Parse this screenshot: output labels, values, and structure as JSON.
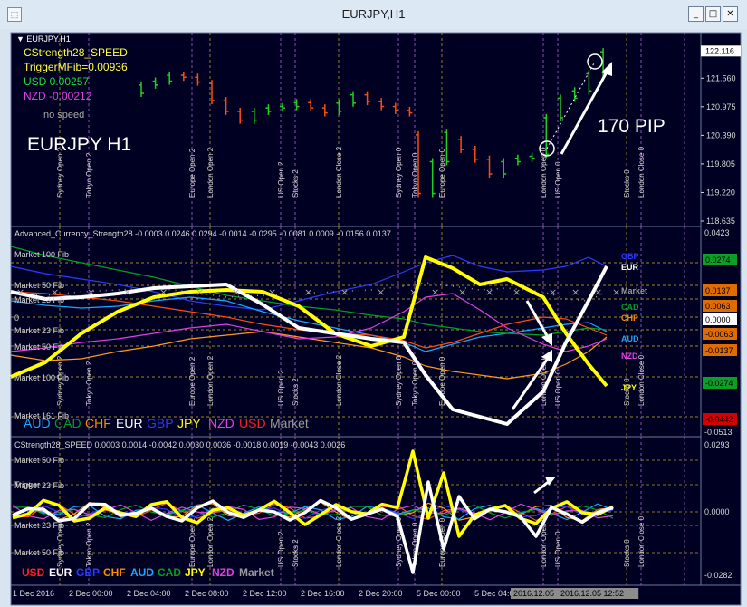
{
  "window": {
    "title": "EURJPY,H1",
    "minimize_glyph": "_",
    "maximize_glyph": "□",
    "close_glyph": "✕",
    "app_icon": "chart-window-icon"
  },
  "main_panel": {
    "label": "▼ EURJPY.H1",
    "indicator_name": "CStrength28_SPEED",
    "trigger_text": "TriggerMFib=0.00936",
    "usd_text": "USD 0.00257",
    "nzd_text": "NZD -0.00212",
    "nospeed_text": "no speed",
    "symbol_overlay": "EURJPY H1",
    "pip_overlay": "170 PIP",
    "price_labels": [
      "122.116",
      "121.560",
      "120.975",
      "120.390",
      "119.805",
      "119.220",
      "118.635"
    ],
    "prices": [
      122.116,
      121.56,
      120.975,
      120.39,
      119.805,
      119.22,
      118.635
    ],
    "price_range": [
      118.635,
      122.27
    ],
    "candles": [
      {
        "o": 121.25,
        "c": 121.42,
        "color": "green"
      },
      {
        "o": 121.42,
        "c": 121.5,
        "color": "green"
      },
      {
        "o": 121.5,
        "c": 121.62,
        "color": "green"
      },
      {
        "o": 121.62,
        "c": 121.58,
        "color": "red"
      },
      {
        "o": 121.58,
        "c": 121.48,
        "color": "red"
      },
      {
        "o": 121.45,
        "c": 121.1,
        "color": "red"
      },
      {
        "o": 121.1,
        "c": 120.88,
        "color": "red"
      },
      {
        "o": 120.88,
        "c": 120.7,
        "color": "red"
      },
      {
        "o": 120.7,
        "c": 120.88,
        "color": "green"
      },
      {
        "o": 120.88,
        "c": 120.95,
        "color": "green"
      },
      {
        "o": 120.95,
        "c": 120.98,
        "color": "green"
      },
      {
        "o": 120.98,
        "c": 121.06,
        "color": "green"
      },
      {
        "o": 121.06,
        "c": 120.95,
        "color": "red"
      },
      {
        "o": 120.95,
        "c": 120.85,
        "color": "red"
      },
      {
        "o": 120.88,
        "c": 121.05,
        "color": "green"
      },
      {
        "o": 121.05,
        "c": 121.22,
        "color": "green"
      },
      {
        "o": 121.22,
        "c": 121.08,
        "color": "red"
      },
      {
        "o": 121.08,
        "c": 120.98,
        "color": "red"
      },
      {
        "o": 120.98,
        "c": 120.9,
        "color": "red"
      },
      {
        "o": 120.9,
        "c": 120.85,
        "color": "red"
      },
      {
        "o": 120.4,
        "c": 119.2,
        "color": "red"
      },
      {
        "o": 119.2,
        "c": 119.85,
        "color": "green"
      },
      {
        "o": 119.85,
        "c": 120.45,
        "color": "green"
      },
      {
        "o": 120.3,
        "c": 120.1,
        "color": "red"
      },
      {
        "o": 120.1,
        "c": 119.9,
        "color": "red"
      },
      {
        "o": 119.9,
        "c": 119.6,
        "color": "red"
      },
      {
        "o": 119.6,
        "c": 119.85,
        "color": "green"
      },
      {
        "o": 119.85,
        "c": 119.92,
        "color": "green"
      },
      {
        "o": 119.92,
        "c": 119.96,
        "color": "green"
      },
      {
        "o": 120.0,
        "c": 120.75,
        "color": "green"
      },
      {
        "o": 120.75,
        "c": 121.15,
        "color": "green"
      },
      {
        "o": 121.15,
        "c": 121.3,
        "color": "green"
      },
      {
        "o": 121.3,
        "c": 121.65,
        "color": "green"
      },
      {
        "o": 121.65,
        "c": 122.1,
        "color": "green"
      }
    ]
  },
  "strength_panel": {
    "header": "Advanced_Currency_Strength28  -0.0003 0.0246 0.0294 -0.0014 -0.0295 -0.0081 0.0009 -0.0156 0.0137",
    "fib_labels": [
      "Market 100 Fib",
      "Market 50 Fib",
      "Market 23 Fib",
      "0",
      "Market 23 Fib",
      "Market 50 Fib",
      "Market 100 Fib",
      "Market 161 Fib"
    ],
    "scale_top": "0.0423",
    "scale_bottom": "-0.0513",
    "badges": [
      {
        "text": "0.0274",
        "color": "#0b9f25"
      },
      {
        "text": "0.0137",
        "color": "#e06c00"
      },
      {
        "text": "0.0063",
        "color": "#e06c00"
      },
      {
        "text": "0.0000",
        "color": "#ffffff"
      },
      {
        "text": "-0.0063",
        "color": "#e06c00"
      },
      {
        "text": "-0.0137",
        "color": "#e06c00"
      },
      {
        "text": "-0.0274",
        "color": "#0b9f25"
      },
      {
        "text": "-0.0442",
        "color": "#d40000"
      }
    ],
    "right_labels": [
      {
        "text": "GBP",
        "color": "#2d3bff"
      },
      {
        "text": "EUR",
        "color": "#ffffff"
      },
      {
        "text": "Market",
        "color": "#9a9a9a"
      },
      {
        "text": "CAD",
        "color": "#00a020"
      },
      {
        "text": "CHF",
        "color": "#ff8c00"
      },
      {
        "text": "AUD",
        "color": "#19a9ff"
      },
      {
        "text": "NZD",
        "color": "#e040e0"
      },
      {
        "text": "JPY",
        "color": "#ffff00"
      }
    ],
    "legend": [
      {
        "text": "AUD",
        "color": "#19a9ff"
      },
      {
        "text": "CAD",
        "color": "#00a020"
      },
      {
        "text": "CHF",
        "color": "#ff8c00"
      },
      {
        "text": "EUR",
        "color": "#ffffff"
      },
      {
        "text": "GBP",
        "color": "#2d3bff"
      },
      {
        "text": "JPY",
        "color": "#ffff00"
      },
      {
        "text": "NZD",
        "color": "#e040e0"
      },
      {
        "text": "USD",
        "color": "#ff2020"
      },
      {
        "text": "Market",
        "color": "#9a9a9a"
      }
    ]
  },
  "speed_panel": {
    "header": "CStrength28_SPEED  0.0003 0.0014 -0.0042 0.0030 0.0036 -0.0018 0.0019 -0.0043 0.0026",
    "fib_labels": [
      "Market 50 Fib",
      "Trigger",
      "Market 23 Fib",
      "Market 23 Fib",
      "Market 50 Fib"
    ],
    "scale_top": "0.0293",
    "scale_mid": "0.0000",
    "scale_bottom": "-0.0282",
    "legend": [
      {
        "text": "USD",
        "color": "#ff2020"
      },
      {
        "text": "EUR",
        "color": "#ffffff"
      },
      {
        "text": "GBP",
        "color": "#2d3bff"
      },
      {
        "text": "CHF",
        "color": "#ff8c00"
      },
      {
        "text": "AUD",
        "color": "#19a9ff"
      },
      {
        "text": "CAD",
        "color": "#00a020"
      },
      {
        "text": "JPY",
        "color": "#ffff00"
      },
      {
        "text": "NZD",
        "color": "#e040e0"
      },
      {
        "text": "Market",
        "color": "#9a9a9a"
      }
    ]
  },
  "sessions": [
    "Sydney Open 2",
    "Tokyo Open 2",
    "Europe Open 2",
    "London Open 2",
    "US Open 2",
    "Stocks 2",
    "London Close 2",
    "Sydney Open 0",
    "Tokyo Open 0",
    "Europe Open 0",
    "London Open 0",
    "US Open 0",
    "Stocks 0",
    "London Close 0"
  ],
  "time_axis": [
    "1 Dec 2016",
    "2 Dec 00:00",
    "2 Dec 04:00",
    "2 Dec 08:00",
    "2 Dec 12:00",
    "2 Dec 16:00",
    "2 Dec 20:00",
    "5 Dec 00:00",
    "5 Dec 04:00",
    "2016.12.05",
    "2016.12.05 12:52"
  ],
  "colors": {
    "chart_bg": "#000022",
    "grid": "#233a66",
    "border": "#6a7ba0",
    "text": "#d8d8d8",
    "green": "#1fd11f",
    "red": "#ff4b12",
    "yellow": "#ffff00",
    "white": "#ffffff",
    "orange": "#ff9a1a",
    "blue": "#2d3bff",
    "magenta": "#e040e0",
    "cyan": "#19a9ff",
    "darkgreen": "#00a020",
    "grey": "#9a9a9a"
  }
}
